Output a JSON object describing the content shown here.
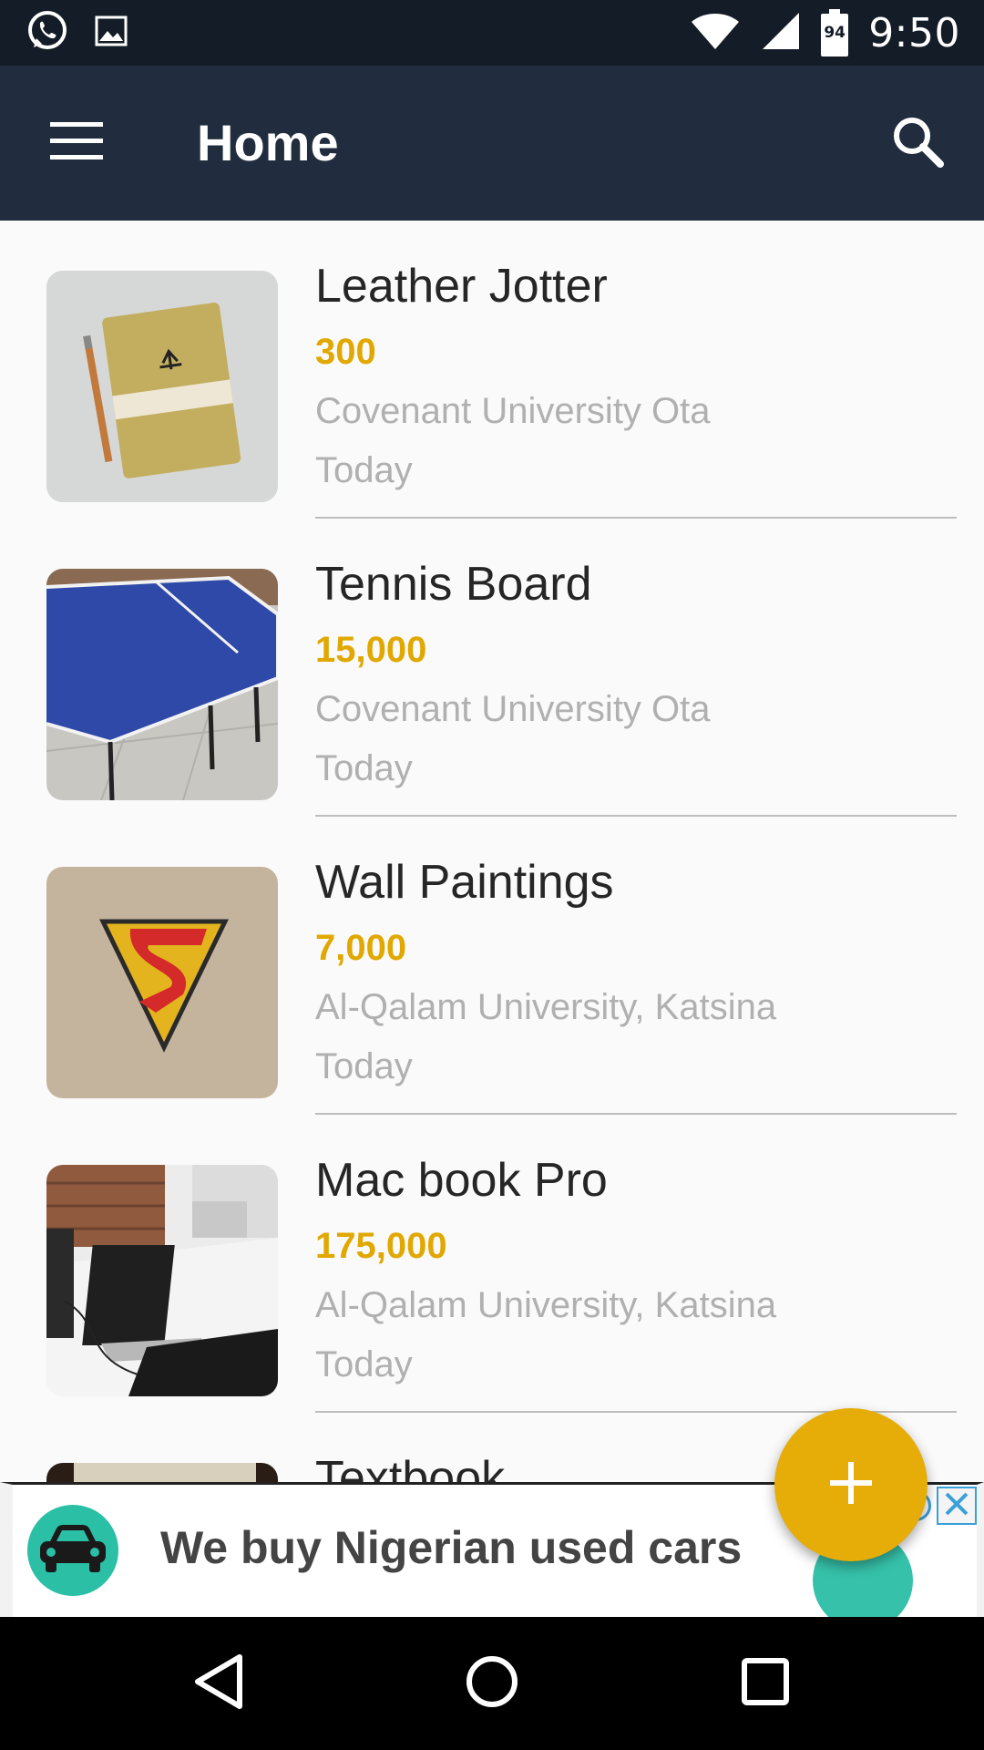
{
  "status_bar": {
    "time": "9:50",
    "battery_level": "94",
    "icons": [
      "whatsapp-icon",
      "image-icon",
      "wifi-icon",
      "signal-icon",
      "battery-icon"
    ]
  },
  "app_bar": {
    "title": "Home",
    "menu_icon": "hamburger-menu-icon",
    "search_icon": "search-icon"
  },
  "listings": [
    {
      "title": "Leather Jotter",
      "price": "300",
      "location": "Covenant University Ota",
      "date": "Today",
      "image": "notebook-photo"
    },
    {
      "title": "Tennis Board",
      "price": "15,000",
      "location": "Covenant University Ota",
      "date": "Today",
      "image": "table-tennis-photo"
    },
    {
      "title": "Wall Paintings",
      "price": "7,000",
      "location": "Al-Qalam University, Katsina",
      "date": "Today",
      "image": "superman-logo-painting-photo"
    },
    {
      "title": "Mac book Pro",
      "price": "175,000",
      "location": "Al-Qalam University, Katsina",
      "date": "Today",
      "image": "laptops-on-desk-photo"
    },
    {
      "title": "Textbook",
      "price": "",
      "location": "",
      "date": "",
      "image": "textbook-cover-photo"
    }
  ],
  "ad": {
    "text": "We buy Nigerian used cars",
    "logo_icon": "car-icon"
  },
  "fab": {
    "icon": "plus-icon"
  },
  "nav_bar": {
    "icons": [
      "back-icon",
      "home-icon",
      "recents-icon"
    ]
  },
  "colors": {
    "status_bar": "#141c27",
    "app_bar": "#212d3e",
    "price": "#e0a800",
    "fab": "#e6ad09",
    "ad_logo": "#2bbfa5"
  }
}
